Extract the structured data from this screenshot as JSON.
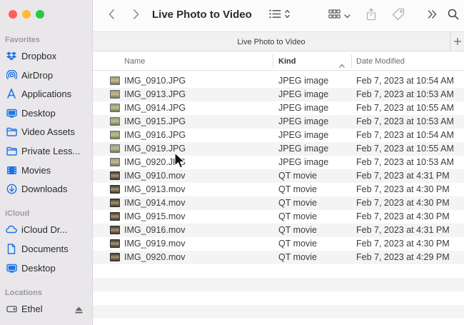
{
  "window": {
    "title": "Live Photo to Video",
    "tab_title": "Live Photo to Video"
  },
  "sidebar": {
    "favorites_title": "Favorites",
    "favorites": [
      {
        "label": "Dropbox",
        "icon": "dropbox-icon"
      },
      {
        "label": "AirDrop",
        "icon": "airdrop-icon"
      },
      {
        "label": "Applications",
        "icon": "applications-icon"
      },
      {
        "label": "Desktop",
        "icon": "desktop-icon"
      },
      {
        "label": "Video Assets",
        "icon": "folder-icon"
      },
      {
        "label": "Private Less...",
        "icon": "folder-icon"
      },
      {
        "label": "Movies",
        "icon": "movies-icon"
      },
      {
        "label": "Downloads",
        "icon": "downloads-icon"
      }
    ],
    "icloud_title": "iCloud",
    "icloud": [
      {
        "label": "iCloud Dr...",
        "icon": "icloud-icon"
      },
      {
        "label": "Documents",
        "icon": "document-icon"
      },
      {
        "label": "Desktop",
        "icon": "desktop-icon"
      }
    ],
    "locations_title": "Locations",
    "locations": [
      {
        "label": "Ethel",
        "icon": "disk-icon"
      }
    ]
  },
  "columns": {
    "name": "Name",
    "kind": "Kind",
    "date": "Date Modified"
  },
  "files": [
    {
      "name": "IMG_0910.JPG",
      "kind": "JPEG image",
      "date": "Feb 7, 2023 at 10:54 AM",
      "type": "jpg"
    },
    {
      "name": "IMG_0913.JPG",
      "kind": "JPEG image",
      "date": "Feb 7, 2023 at 10:53 AM",
      "type": "jpg"
    },
    {
      "name": "IMG_0914.JPG",
      "kind": "JPEG image",
      "date": "Feb 7, 2023 at 10:55 AM",
      "type": "jpg"
    },
    {
      "name": "IMG_0915.JPG",
      "kind": "JPEG image",
      "date": "Feb 7, 2023 at 10:53 AM",
      "type": "jpg"
    },
    {
      "name": "IMG_0916.JPG",
      "kind": "JPEG image",
      "date": "Feb 7, 2023 at 10:54 AM",
      "type": "jpg"
    },
    {
      "name": "IMG_0919.JPG",
      "kind": "JPEG image",
      "date": "Feb 7, 2023 at 10:55 AM",
      "type": "jpg"
    },
    {
      "name": "IMG_0920.JPG",
      "kind": "JPEG image",
      "date": "Feb 7, 2023 at 10:53 AM",
      "type": "jpg"
    },
    {
      "name": "IMG_0910.mov",
      "kind": "QT movie",
      "date": "Feb 7, 2023 at 4:31 PM",
      "type": "mov"
    },
    {
      "name": "IMG_0913.mov",
      "kind": "QT movie",
      "date": "Feb 7, 2023 at 4:30 PM",
      "type": "mov"
    },
    {
      "name": "IMG_0914.mov",
      "kind": "QT movie",
      "date": "Feb 7, 2023 at 4:30 PM",
      "type": "mov"
    },
    {
      "name": "IMG_0915.mov",
      "kind": "QT movie",
      "date": "Feb 7, 2023 at 4:30 PM",
      "type": "mov"
    },
    {
      "name": "IMG_0916.mov",
      "kind": "QT movie",
      "date": "Feb 7, 2023 at 4:31 PM",
      "type": "mov"
    },
    {
      "name": "IMG_0919.mov",
      "kind": "QT movie",
      "date": "Feb 7, 2023 at 4:30 PM",
      "type": "mov"
    },
    {
      "name": "IMG_0920.mov",
      "kind": "QT movie",
      "date": "Feb 7, 2023 at 4:29 PM",
      "type": "mov"
    }
  ],
  "colors": {
    "accent": "#1a73e8",
    "sidebar_bg": "#e9e7ea",
    "alt_row": "#f4f4f5"
  }
}
